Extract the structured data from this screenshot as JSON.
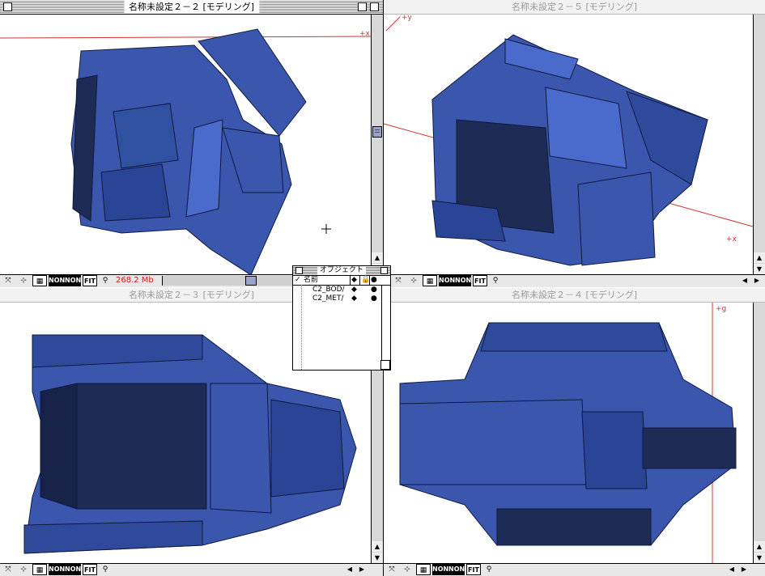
{
  "windows": {
    "top_left": {
      "title": "名称未設定２－２ [モデリング]",
      "axis_label": "+x",
      "memory": "268.2 Mb"
    },
    "top_right": {
      "title": "名称未設定２－５ [モデリング]",
      "axis_x": "+x",
      "axis_y": "+y"
    },
    "bottom_left": {
      "title": "名称未設定２－３ [モデリング]"
    },
    "bottom_right": {
      "title": "名称未設定２－４ [モデリング]",
      "axis_label": "+g"
    }
  },
  "toolbar": {
    "none_label_1": "NONE",
    "none_label_2": "NONE",
    "fit_label": "FIT"
  },
  "object_palette": {
    "title": "オブジェクト",
    "header": {
      "name": "名前",
      "check": "✓"
    },
    "items": [
      {
        "name": "C2_BOD/",
        "marker": "◆",
        "dot": "●"
      },
      {
        "name": "C2_MET/",
        "marker": "◆",
        "dot": "●"
      }
    ]
  },
  "colors": {
    "model_blue": "#3a57ad",
    "model_dark": "#1e2b55",
    "axis_red": "#d43232"
  },
  "icons": {
    "cursor": "crosshair-icon",
    "close": "close-box-icon",
    "zoom": "zoom-box-icon"
  }
}
